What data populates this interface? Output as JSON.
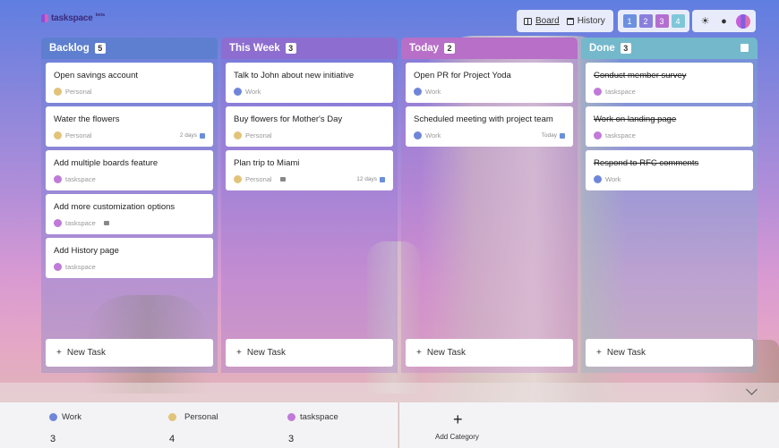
{
  "app": {
    "logo": "taskspace",
    "logo_badge": "beta"
  },
  "header": {
    "views": [
      {
        "label": "Board",
        "icon": "board-icon",
        "active": true
      },
      {
        "label": "History",
        "icon": "history-icon",
        "active": false
      }
    ],
    "boards": [
      {
        "label": "1",
        "color": "#6c8fe0"
      },
      {
        "label": "2",
        "color": "#8a7fdc"
      },
      {
        "label": "3",
        "color": "#b36fd0"
      },
      {
        "label": "4",
        "color": "#7ec7d8"
      }
    ],
    "tools": [
      "sun-icon",
      "bulb-icon",
      "avatar"
    ]
  },
  "categories": {
    "Work": "#6f86d8",
    "Personal": "#e2c37a",
    "taskspace": "#c07ad8"
  },
  "columns": [
    {
      "title": "Backlog",
      "count": "5",
      "color": "#5e7fcf",
      "tasks": [
        {
          "title": "Open savings account",
          "category": "Personal"
        },
        {
          "title": "Water the flowers",
          "category": "Personal",
          "due": "2 days"
        },
        {
          "title": "Add multiple boards feature",
          "category": "taskspace"
        },
        {
          "title": "Add more customization options",
          "category": "taskspace",
          "note": true
        },
        {
          "title": "Add History page",
          "category": "taskspace"
        }
      ],
      "new_task": "New Task"
    },
    {
      "title": "This Week",
      "count": "3",
      "color": "#8d6dcf",
      "tasks": [
        {
          "title": "Talk to John about new initiative",
          "category": "Work"
        },
        {
          "title": "Buy flowers for Mother's Day",
          "category": "Personal"
        },
        {
          "title": "Plan trip to Miami",
          "category": "Personal",
          "note": true,
          "due": "12 days"
        }
      ],
      "new_task": "New Task"
    },
    {
      "title": "Today",
      "count": "2",
      "color": "#b76fc8",
      "tasks": [
        {
          "title": "Open PR for Project Yoda",
          "category": "Work"
        },
        {
          "title": "Scheduled meeting with project team",
          "category": "Work",
          "due": "Today"
        }
      ],
      "new_task": "New Task"
    },
    {
      "title": "Done",
      "count": "3",
      "color": "#74b8cc",
      "done": true,
      "tasks": [
        {
          "title": "Conduct member survey",
          "category": "taskspace"
        },
        {
          "title": "Work on landing page",
          "category": "taskspace"
        },
        {
          "title": "Respond to RFC comments",
          "category": "Work"
        }
      ],
      "new_task": "New Task"
    }
  ],
  "footer": {
    "categories": [
      {
        "name": "Work",
        "count": "3"
      },
      {
        "name": "Personal",
        "count": "4"
      },
      {
        "name": "taskspace",
        "count": "3"
      }
    ],
    "add_category": "Add Category"
  }
}
